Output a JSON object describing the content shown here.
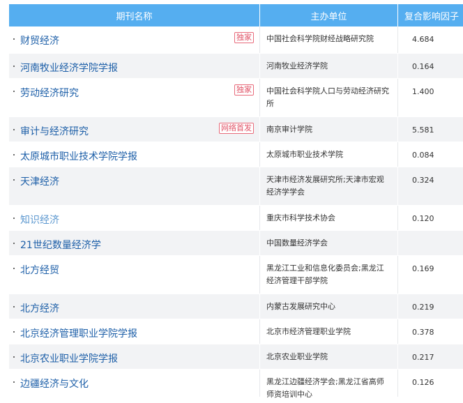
{
  "columns": {
    "name": "期刊名称",
    "unit": "主办单位",
    "factor": "复合影响因子"
  },
  "rows": [
    {
      "name": "财贸经济",
      "tag": "独家",
      "unit": "中国社会科学院财经战略研究院",
      "factor": "4.684"
    },
    {
      "name": "河南牧业经济学院学报",
      "tag": "",
      "unit": "河南牧业经济学院",
      "factor": "0.164"
    },
    {
      "name": "劳动经济研究",
      "tag": "独家",
      "unit": "中国社会科学院人口与劳动经济研究所",
      "factor": "1.400"
    },
    {
      "name": "审计与经济研究",
      "tag": "网络首发",
      "unit": "南京审计学院",
      "factor": "5.581"
    },
    {
      "name": "太原城市职业技术学院学报",
      "tag": "",
      "unit": "太原城市职业技术学院",
      "factor": "0.084"
    },
    {
      "name": "天津经济",
      "tag": "",
      "unit": "天津市经济发展研究所;天津市宏观经济学学会",
      "factor": "0.324"
    },
    {
      "name": "知识经济",
      "tag": "",
      "unit": "重庆市科学技术协会",
      "factor": "0.120"
    },
    {
      "name": "21世纪数量经济学",
      "tag": "",
      "unit": "中国数量经济学会",
      "factor": ""
    },
    {
      "name": "北方经贸",
      "tag": "",
      "unit": "黑龙江工业和信息化委员会;黑龙江经济管理干部学院",
      "factor": "0.169"
    },
    {
      "name": "北方经济",
      "tag": "",
      "unit": "内蒙古发展研究中心",
      "factor": "0.219"
    },
    {
      "name": "北京经济管理职业学院学报",
      "tag": "",
      "unit": "北京市经济管理职业学院",
      "factor": "0.378"
    },
    {
      "name": "北京农业职业学院学报",
      "tag": "",
      "unit": "北京农业职业学院",
      "factor": "0.217"
    },
    {
      "name": "边疆经济与文化",
      "tag": "",
      "unit": "黑龙江边疆经济学会;黑龙江省高师师资培训中心",
      "factor": "0.126"
    }
  ]
}
